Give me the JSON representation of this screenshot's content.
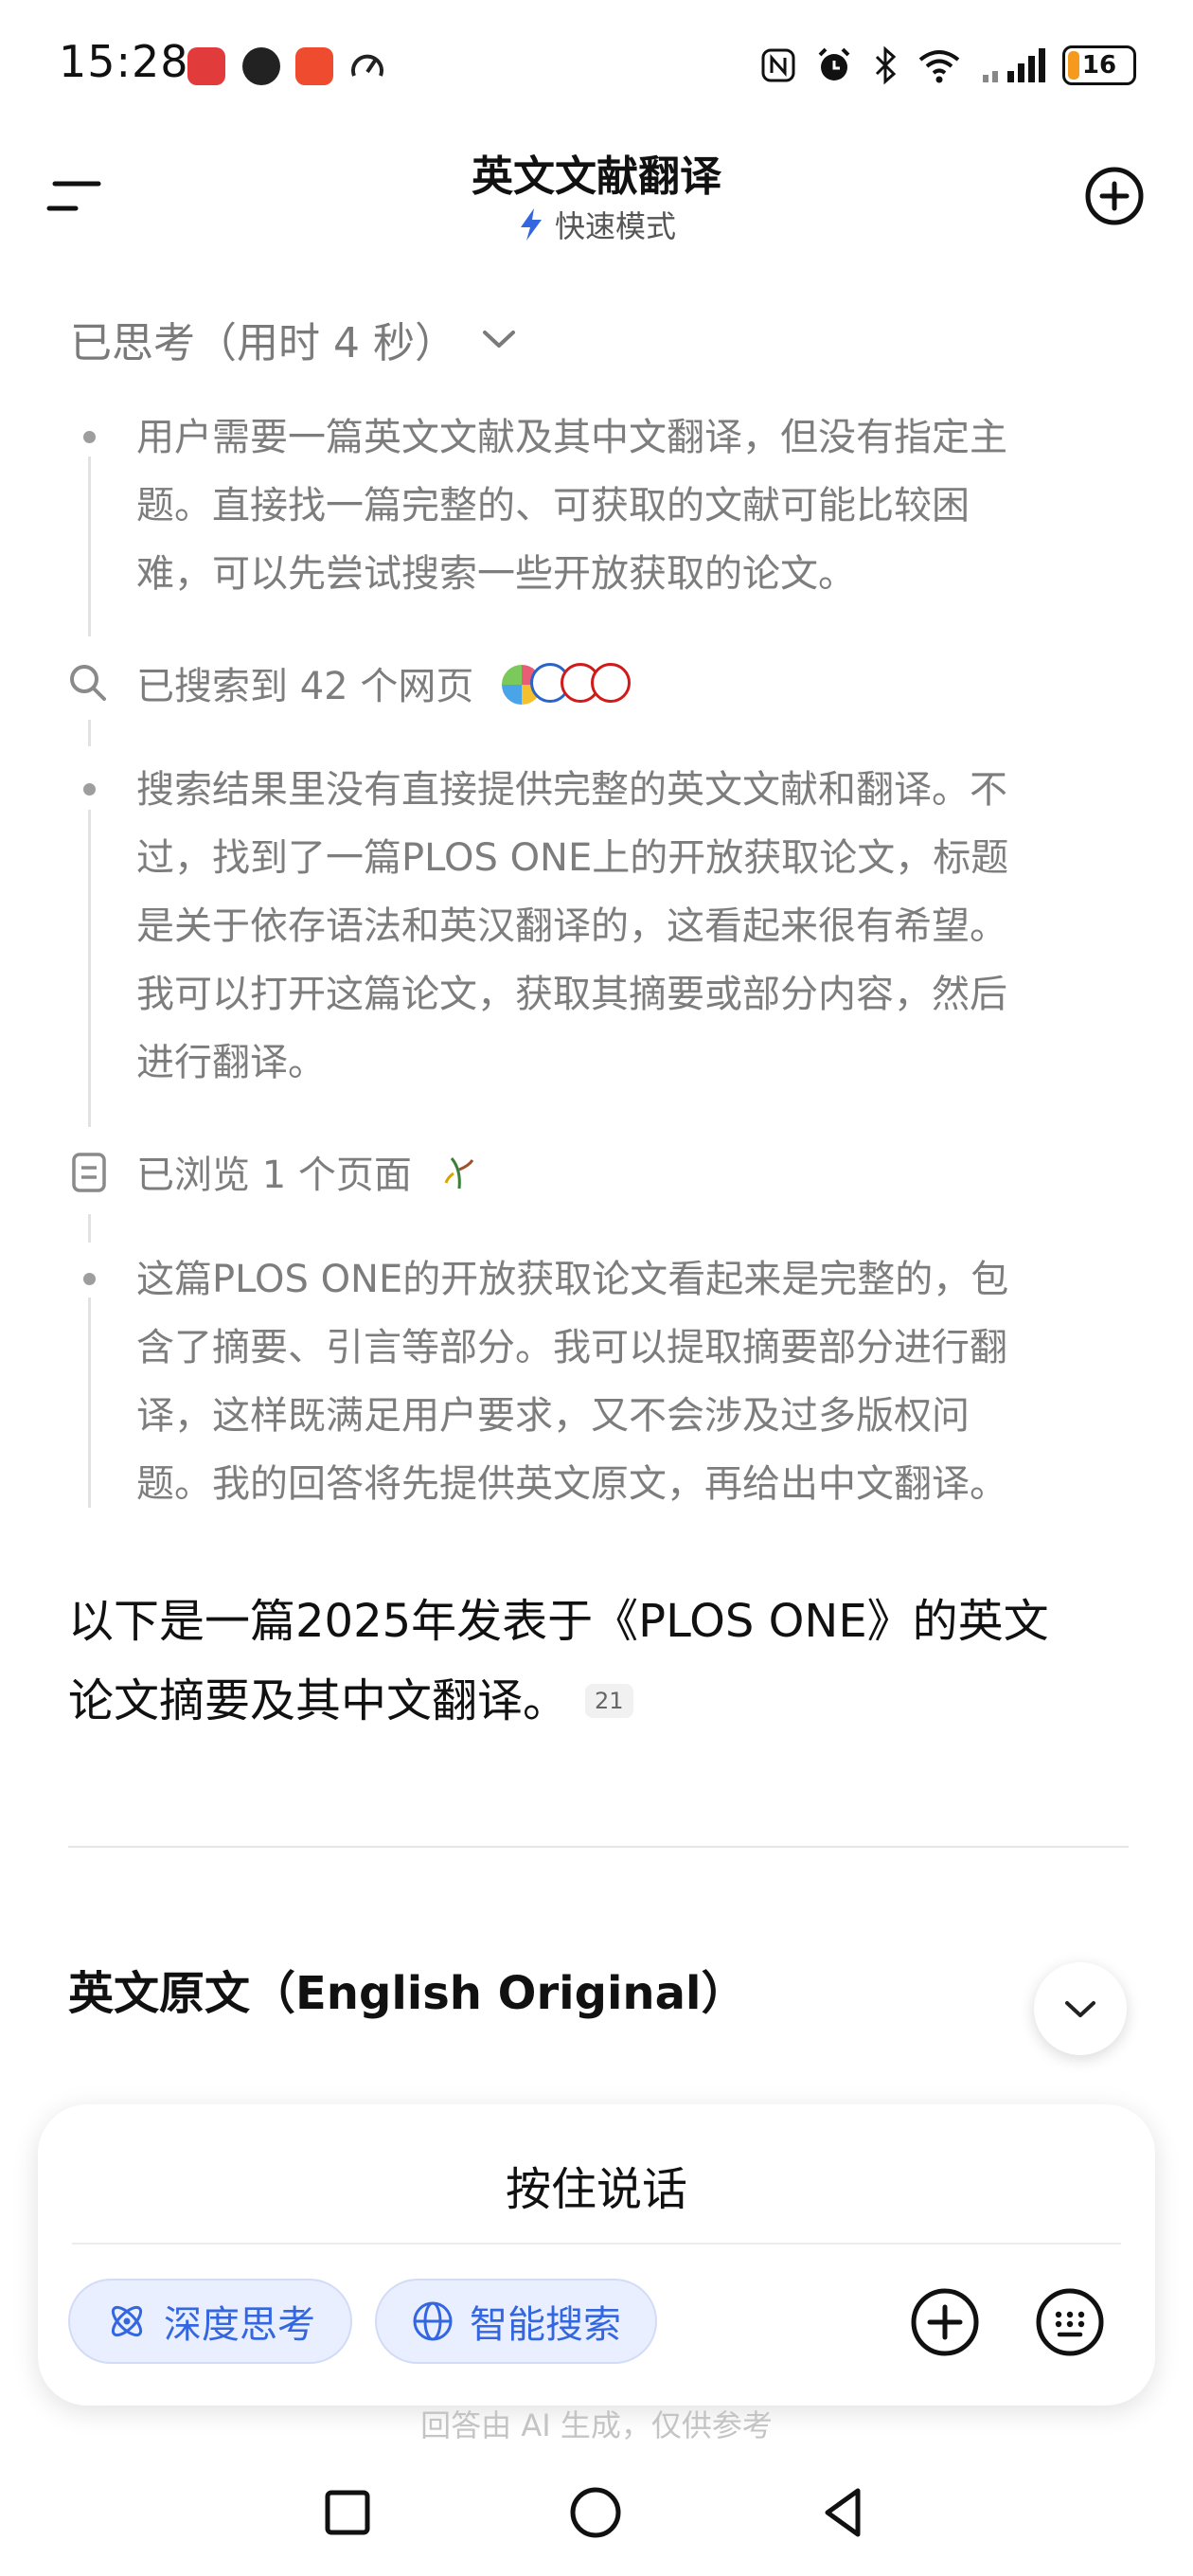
{
  "status_bar": {
    "time": "15:28",
    "battery": "16",
    "icons": [
      "nfc-icon",
      "alarm-icon",
      "bluetooth-icon",
      "wifi-icon",
      "signal-icon"
    ]
  },
  "header": {
    "title": "英文文献翻译",
    "mode": "快速模式",
    "menu_icon": "menu-icon",
    "new_chat_icon": "plus-circle-icon"
  },
  "thinking": {
    "header": "已思考（用时 4 秒）",
    "paragraphs": [
      [
        "用户需要一篇英文文献及其中文翻译，但没有指定主",
        "题。直接找一篇完整的、可获取的文献可能比较困",
        "难，可以先尝试搜索一些开放获取的论文。"
      ],
      [
        "搜索结果里没有直接提供完整的英文文献和翻译。不",
        "过，找到了一篇PLOS ONE上的开放获取论文，标题",
        "是关于依存语法和英汉翻译的，这看起来很有希望。",
        "我可以打开这篇论文，获取其摘要或部分内容，然后",
        "进行翻译。"
      ],
      [
        "这篇PLOS ONE的开放获取论文看起来是完整的，包",
        "含了摘要、引言等部分。我可以提取摘要部分进行翻",
        "译，这样既满足用户要求，又不会涉及过多版权问",
        "题。我的回答将先提供英文原文，再给出中文翻译。"
      ]
    ],
    "search_step": "已搜索到 42 个网页",
    "browse_step": "已浏览 1 个页面"
  },
  "answer": {
    "lines": [
      "以下是一篇2025年发表于《PLOS ONE》的英文",
      "论文摘要及其中文翻译。"
    ],
    "ref": "21",
    "section_heading": "英文原文（English Original）"
  },
  "input": {
    "hold_to_talk": "按住说话",
    "deep_think": "深度思考",
    "smart_search": "智能搜索"
  },
  "disclaimer": "回答由 AI 生成，仅供参考",
  "colors": {
    "accent": "#3466e0",
    "pill_bg": "#e9effe",
    "muted_text": "#7d7d7d",
    "battery_low": "#f59a1d"
  }
}
